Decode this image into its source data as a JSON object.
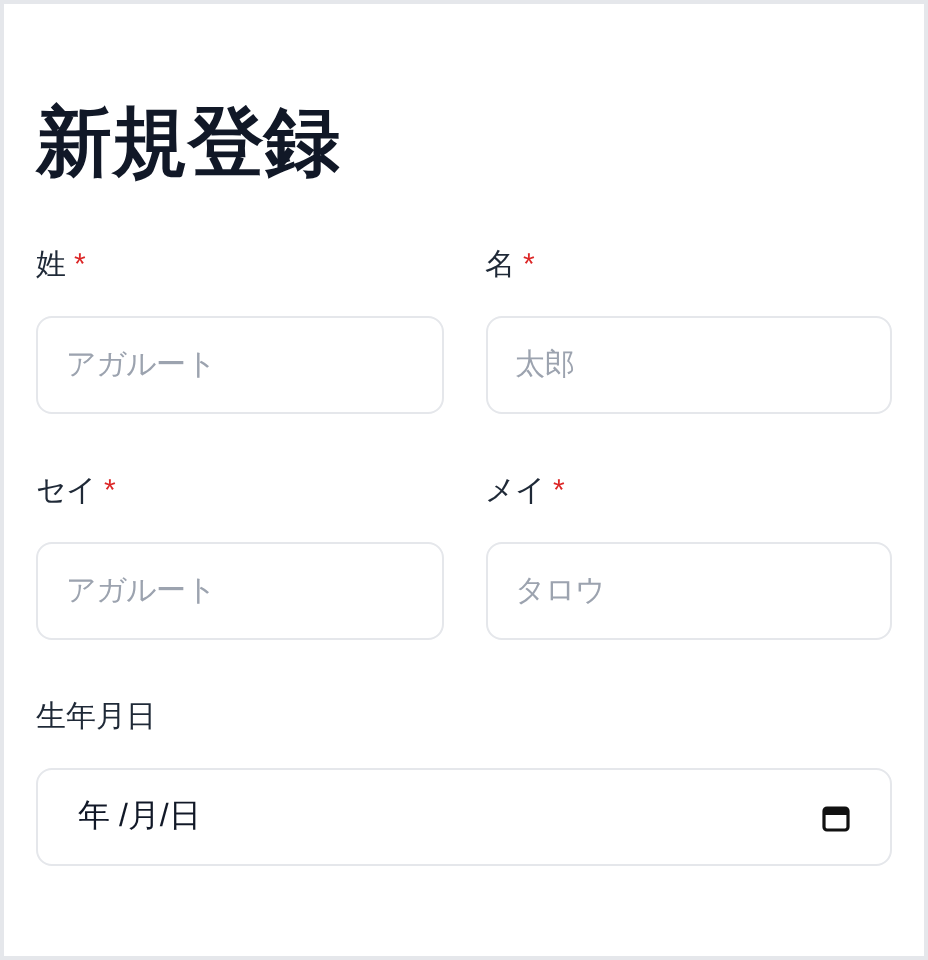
{
  "title": "新規登録",
  "fields": [
    {
      "label": "姓",
      "required": true,
      "placeholder": "アガルート"
    },
    {
      "label": "名",
      "required": true,
      "placeholder": "太郎"
    },
    {
      "label": "セイ",
      "required": true,
      "placeholder": "アガルート"
    },
    {
      "label": "メイ",
      "required": true,
      "placeholder": "タロウ"
    }
  ],
  "required_mark": "*",
  "birthdate": {
    "label": "生年月日",
    "value": "年 /月/日"
  }
}
